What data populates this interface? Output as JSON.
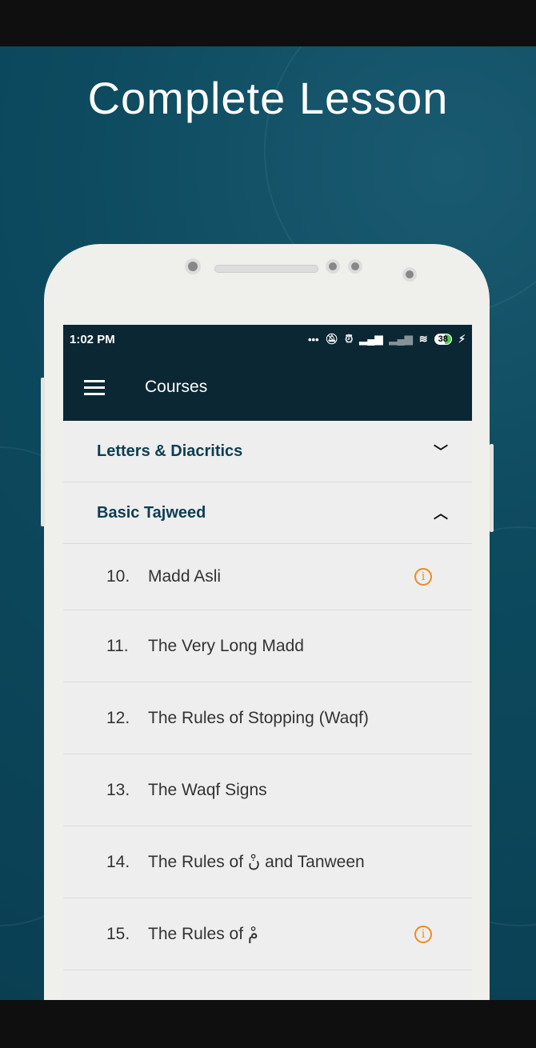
{
  "headline": "Complete Lesson",
  "status": {
    "time": "1:02 PM",
    "battery": "38"
  },
  "toolbar": {
    "title": "Courses"
  },
  "sections": [
    {
      "label": "Letters & Diacritics",
      "expanded": false
    },
    {
      "label": "Basic Tajweed",
      "expanded": true
    }
  ],
  "lessons": [
    {
      "num": "10.",
      "title": "Madd Asli",
      "info": true
    },
    {
      "num": "11.",
      "title": "The Very Long Madd",
      "info": false
    },
    {
      "num": "12.",
      "title": "The Rules of Stopping (Waqf)",
      "info": false
    },
    {
      "num": "13.",
      "title": "The Waqf Signs",
      "info": false
    },
    {
      "num": "14.",
      "title": "The Rules of نْ and Tanween",
      "info": false
    },
    {
      "num": "15.",
      "title": "The Rules of مْ",
      "info": true
    }
  ],
  "colors": {
    "accent": "#f08a1c",
    "header": "#0b2733",
    "section_text": "#0d3d52"
  }
}
